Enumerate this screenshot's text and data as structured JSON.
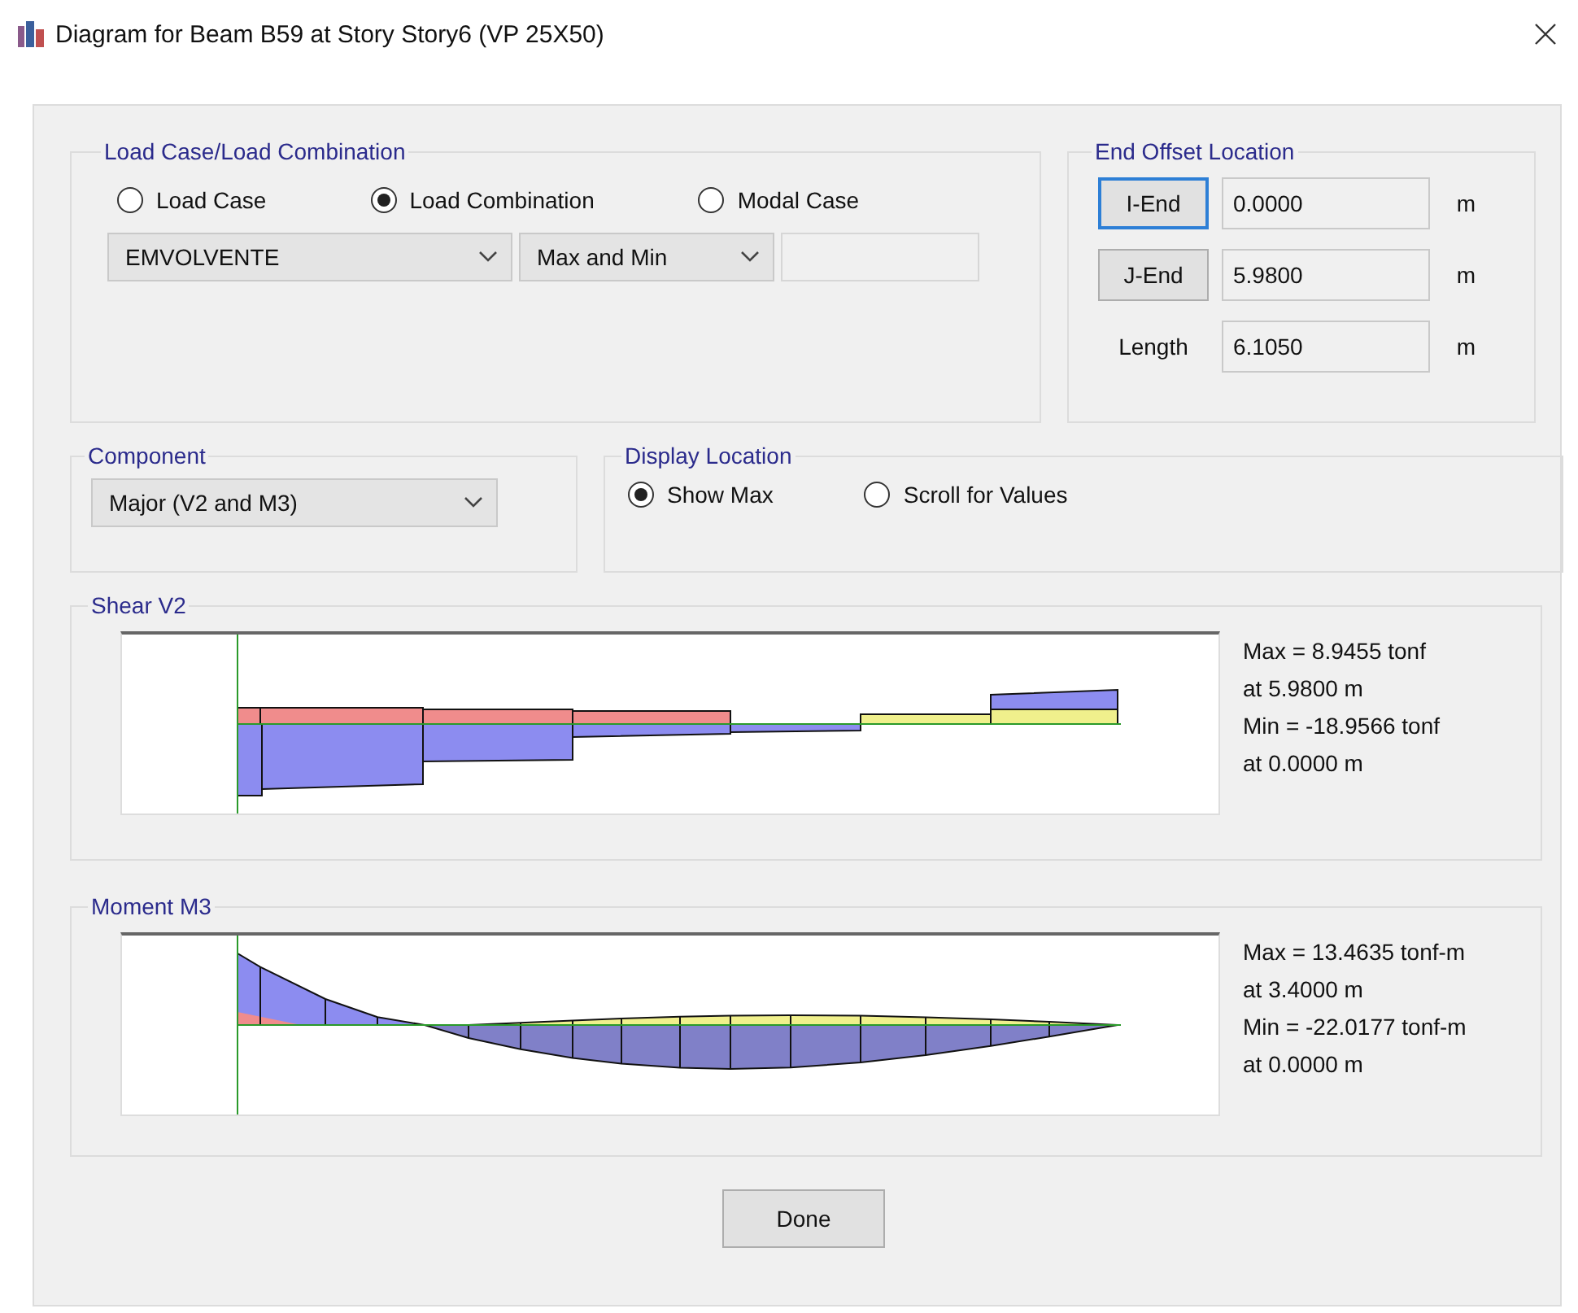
{
  "window": {
    "title": "Diagram for Beam B59 at Story Story6 (VP 25X50)"
  },
  "load_case": {
    "title": "Load Case/Load Combination",
    "options": [
      {
        "label": "Load Case",
        "selected": false
      },
      {
        "label": "Load Combination",
        "selected": true
      },
      {
        "label": "Modal Case",
        "selected": false
      }
    ],
    "combination": "EMVOLVENTE",
    "envelope": "Max and Min"
  },
  "end_offset": {
    "title": "End Offset Location",
    "rows": [
      {
        "kind": "button",
        "label": "I-End",
        "focused": true,
        "value": "0.0000",
        "unit": "m"
      },
      {
        "kind": "button",
        "label": "J-End",
        "focused": false,
        "value": "5.9800",
        "unit": "m"
      },
      {
        "kind": "label",
        "label": "Length",
        "value": "6.1050",
        "unit": "m"
      }
    ]
  },
  "component": {
    "title": "Component",
    "value": "Major (V2 and M3)"
  },
  "display_location": {
    "title": "Display Location",
    "options": [
      {
        "label": "Show Max",
        "selected": true
      },
      {
        "label": "Scroll for Values",
        "selected": false
      }
    ]
  },
  "diagrams": [
    {
      "kind": "shear",
      "title": "Shear V2",
      "results": [
        "Max = 8.9455 tonf",
        "at 5.9800 m",
        "Min = -18.9566 tonf",
        "at 0.0000 m"
      ]
    },
    {
      "kind": "moment",
      "title": "Moment M3",
      "results": [
        "Max = 13.4635 tonf-m",
        "at 3.4000 m",
        "Min = -22.0177 tonf-m",
        "at 0.0000 m"
      ]
    }
  ],
  "done_button": "Done"
}
